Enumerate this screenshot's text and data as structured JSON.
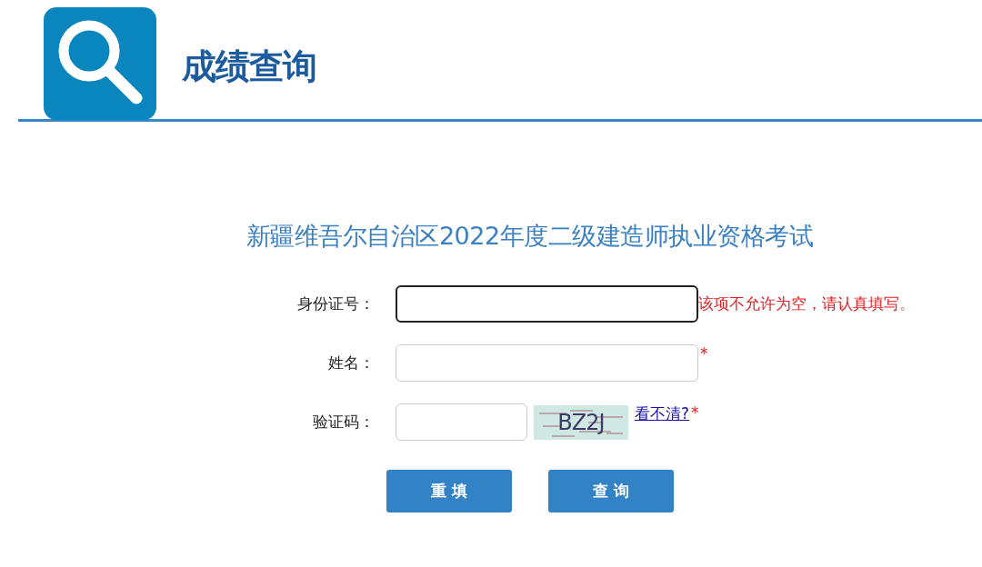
{
  "header": {
    "title": "成绩查询"
  },
  "exam_title": "新疆维吾尔自治区2022年度二级建造师执业资格考试",
  "form": {
    "fields": [
      {
        "label": "身份证号：",
        "kind": "text",
        "focused": true,
        "note": {
          "kind": "error",
          "text": "该项不允许为空，请认真填写。"
        }
      },
      {
        "label": "姓名：",
        "kind": "text",
        "focused": false,
        "note": {
          "kind": "required",
          "text": "*"
        }
      },
      {
        "label": "验证码：",
        "kind": "captcha",
        "focused": false,
        "captcha_text": "BZ2J",
        "refresh_link": "看不清? ",
        "note": {
          "kind": "required",
          "text": "*"
        }
      }
    ]
  },
  "buttons": [
    "重 填",
    "查 询"
  ]
}
